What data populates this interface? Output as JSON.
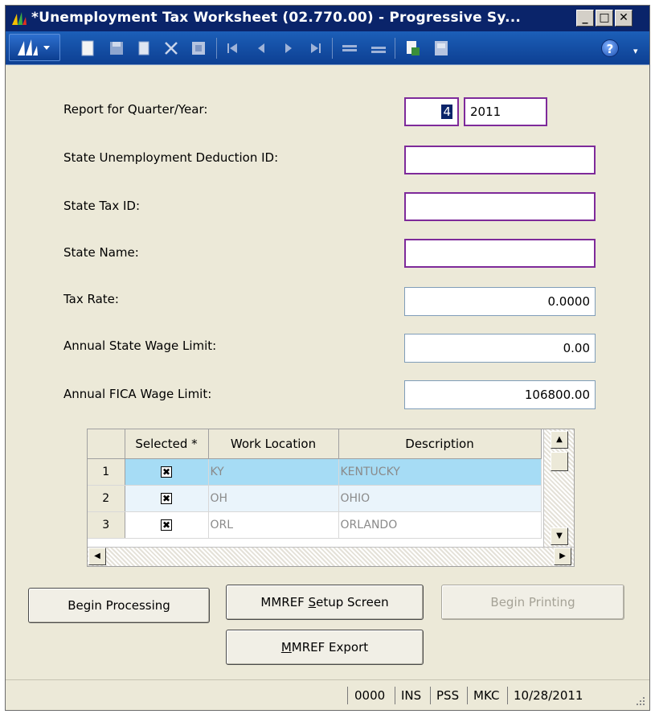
{
  "window": {
    "title": "*Unemployment Tax Worksheet (02.770.00) - Progressive Sy...",
    "minimize_glyph": "_",
    "maximize_glyph": "□",
    "close_glyph": "✕"
  },
  "toolbar": {
    "icons": [
      "menu-icon",
      "new-icon",
      "save-icon",
      "copy-icon",
      "delete-icon",
      "cancel-icon",
      "first-icon",
      "previous-icon",
      "next-icon",
      "last-icon",
      "insert-row-icon",
      "delete-row-icon",
      "print-icon",
      "export-icon",
      "help-icon"
    ],
    "help_glyph": "?",
    "overflow_glyph": "▾"
  },
  "form": {
    "quarter_year": {
      "label": "Report for Quarter/Year:",
      "quarter": "4",
      "year": "2011"
    },
    "state_deduction_id": {
      "label": "State Unemployment Deduction ID:",
      "value": ""
    },
    "state_tax_id": {
      "label": "State Tax ID:",
      "value": ""
    },
    "state_name": {
      "label": "State Name:",
      "value": ""
    },
    "tax_rate": {
      "label": "Tax Rate:",
      "value": "0.0000"
    },
    "annual_state_wage_limit": {
      "label": "Annual State Wage Limit:",
      "value": "0.00"
    },
    "annual_fica_wage_limit": {
      "label": "Annual FICA Wage Limit:",
      "value": "106800.00"
    }
  },
  "grid": {
    "columns": [
      "Selected *",
      "Work Location",
      "Description"
    ],
    "rows": [
      {
        "num": "1",
        "selected": "✖",
        "location": "KY",
        "description": "KENTUCKY"
      },
      {
        "num": "2",
        "selected": "✖",
        "location": "OH",
        "description": "OHIO"
      },
      {
        "num": "3",
        "selected": "✖",
        "location": "ORL",
        "description": "ORLANDO"
      }
    ],
    "scroll_up": "▲",
    "scroll_down": "▼",
    "scroll_left": "◀",
    "scroll_right": "▶"
  },
  "buttons": {
    "begin_processing": "Begin Processing",
    "mmref_setup_pre": "MMREF ",
    "mmref_setup_accel": "S",
    "mmref_setup_post": "etup Screen",
    "begin_printing": "Begin Printing",
    "mmref_export_accel": "M",
    "mmref_export_post": "MREF Export"
  },
  "statusbar": {
    "cells": [
      "0000",
      "INS",
      "PSS",
      "MKC",
      "10/28/2011"
    ]
  }
}
